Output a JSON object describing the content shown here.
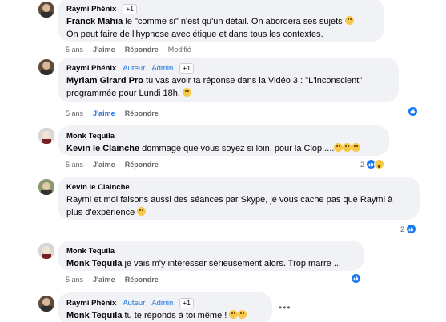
{
  "comments": [
    {
      "author": "Raymi Phénix",
      "roles": [],
      "badge": "+1",
      "mention": "Franck Mahia",
      "lines": [
        " le \"comme si\" n'est qu'un détail. On abordera ses sujets ",
        "On peut faire de l'hypnose avec étique et dans tous les contextes."
      ],
      "time": "5 ans",
      "like": "J'aime",
      "reply": "Répondre",
      "edited": "Modifié"
    },
    {
      "author": "Raymi Phénix",
      "roles": [
        "Auteur",
        "Admin"
      ],
      "badge": "+1",
      "mention": "Myriam Girard Pro",
      "lines": [
        " tu vas avoir ta réponse dans la Vidéo 3 : \"L'inconscient\"",
        "programmée pour Lundi 18h. "
      ],
      "time": "5 ans",
      "like": "J'aime",
      "reply": "Répondre",
      "reactions_count": ""
    },
    {
      "author": "Monk Tequila",
      "mention": "Kevin le Clainche",
      "lines": [
        " dommage que vous soyez si loin, pour la Clop....."
      ],
      "time": "5 ans",
      "like": "J'aime",
      "reply": "Répondre",
      "reactions_count": "2"
    },
    {
      "author": "Kevin le Clainche",
      "lines": [
        "Raymi et moi faisons aussi des séances par Skype, je vous cache pas que Raymi à",
        "plus d'expérience "
      ],
      "time": "5 ans",
      "like": "J'aime",
      "reply": "Répondre",
      "reactions_count": "2"
    },
    {
      "author": "Monk Tequila",
      "mention": "Monk Tequila",
      "lines": [
        " je vais m'y intéresser sérieusement alors. Trop marre ..."
      ],
      "time": "5 ans",
      "like": "J'aime",
      "reply": "Répondre"
    },
    {
      "author": "Raymi Phénix",
      "roles": [
        "Auteur",
        "Admin"
      ],
      "badge": "+1",
      "mention": "Monk Tequila",
      "lines": [
        " tu te réponds à toi même ! "
      ]
    }
  ],
  "more_label": "•••"
}
